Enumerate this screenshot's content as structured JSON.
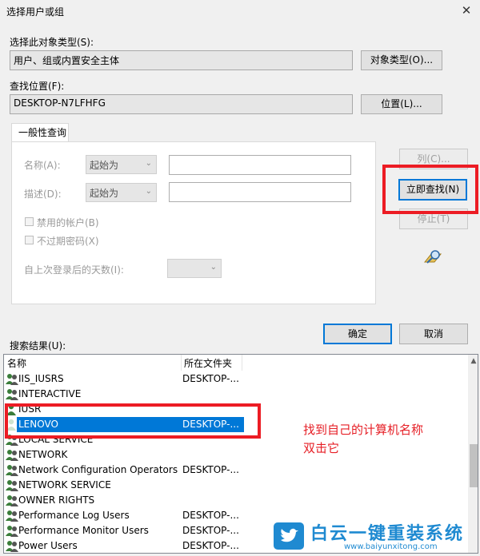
{
  "window": {
    "title": "选择用户或组",
    "close_glyph": "✕"
  },
  "object_type": {
    "label": "选择此对象类型(S):",
    "value": "用户、组或内置安全主体",
    "button": "对象类型(O)..."
  },
  "location": {
    "label": "查找位置(F):",
    "value": "DESKTOP-N7LFHFG",
    "button": "位置(L)..."
  },
  "query": {
    "tab_label": "一般性查询",
    "name_label": "名称(A):",
    "name_mode": "起始为",
    "desc_label": "描述(D):",
    "desc_mode": "起始为",
    "disabled_accounts": "禁用的帐户(B)",
    "no_expire_password": "不过期密码(X)",
    "days_since_logon": "自上次登录后的天数(I):"
  },
  "side_buttons": {
    "columns": "列(C)...",
    "find_now": "立即查找(N)",
    "stop": "停止(T)"
  },
  "dialog_buttons": {
    "ok": "确定",
    "cancel": "取消"
  },
  "results": {
    "label": "搜索结果(U):",
    "col_name": "名称",
    "col_folder": "所在文件夹",
    "rows": [
      {
        "name": "IIS_IUSRS",
        "folder": "DESKTOP-..."
      },
      {
        "name": "INTERACTIVE",
        "folder": ""
      },
      {
        "name": "IUSR",
        "folder": ""
      },
      {
        "name": "LENOVO",
        "folder": "DESKTOP-..."
      },
      {
        "name": "LOCAL SERVICE",
        "folder": ""
      },
      {
        "name": "NETWORK",
        "folder": ""
      },
      {
        "name": "Network Configuration Operators",
        "folder": "DESKTOP-..."
      },
      {
        "name": "NETWORK SERVICE",
        "folder": ""
      },
      {
        "name": "OWNER RIGHTS",
        "folder": ""
      },
      {
        "name": "Performance Log Users",
        "folder": "DESKTOP-..."
      },
      {
        "name": "Performance Monitor Users",
        "folder": "DESKTOP-..."
      },
      {
        "name": "Power Users",
        "folder": "DESKTOP-..."
      }
    ],
    "selected_row": "LENOVO"
  },
  "annotation": {
    "line1": "找到自己的计算机名称",
    "line2": "双击它",
    "color": "#e61e25"
  },
  "watermark": {
    "brand": "白云一键重装系统",
    "url": "www.baiyunxitong.com",
    "color": "#1f8ad1"
  }
}
